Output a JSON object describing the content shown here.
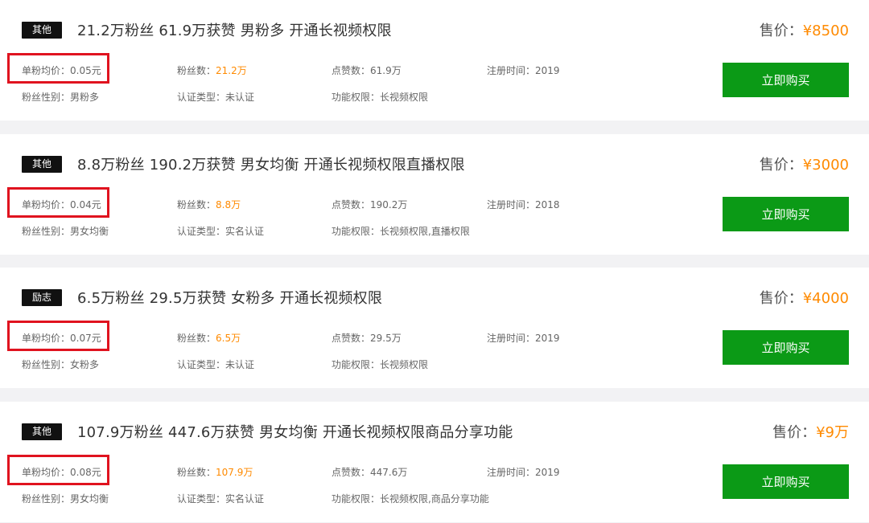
{
  "listings": [
    {
      "category": "其他",
      "title": "21.2万粉丝  61.9万获赞  男粉多  开通长视频权限",
      "price_label": "售价：",
      "price": "¥8500",
      "unit_price_label": "单粉均价：",
      "unit_price": "0.05元",
      "fans_label": "粉丝数：",
      "fans": "21.2万",
      "likes_label": "点赞数：",
      "likes": "61.9万",
      "reg_label": "注册时间：",
      "reg": "2019",
      "gender_label": "粉丝性别：",
      "gender": "男粉多",
      "cert_label": "认证类型：",
      "cert": "未认证",
      "perm_label": "功能权限：",
      "perm": "长视频权限",
      "buy_label": "立即购买"
    },
    {
      "category": "其他",
      "title": "8.8万粉丝  190.2万获赞  男女均衡  开通长视频权限直播权限",
      "price_label": "售价：",
      "price": "¥3000",
      "unit_price_label": "单粉均价：",
      "unit_price": "0.04元",
      "fans_label": "粉丝数：",
      "fans": "8.8万",
      "likes_label": "点赞数：",
      "likes": "190.2万",
      "reg_label": "注册时间：",
      "reg": "2018",
      "gender_label": "粉丝性别：",
      "gender": "男女均衡",
      "cert_label": "认证类型：",
      "cert": "实名认证",
      "perm_label": "功能权限：",
      "perm": "长视频权限,直播权限",
      "buy_label": "立即购买"
    },
    {
      "category": "励志",
      "title": "6.5万粉丝  29.5万获赞  女粉多  开通长视频权限",
      "price_label": "售价：",
      "price": "¥4000",
      "unit_price_label": "单粉均价：",
      "unit_price": "0.07元",
      "fans_label": "粉丝数：",
      "fans": "6.5万",
      "likes_label": "点赞数：",
      "likes": "29.5万",
      "reg_label": "注册时间：",
      "reg": "2019",
      "gender_label": "粉丝性别：",
      "gender": "女粉多",
      "cert_label": "认证类型：",
      "cert": "未认证",
      "perm_label": "功能权限：",
      "perm": "长视频权限",
      "buy_label": "立即购买"
    },
    {
      "category": "其他",
      "title": "107.9万粉丝  447.6万获赞  男女均衡  开通长视频权限商品分享功能",
      "price_label": "售价：",
      "price": "¥9万",
      "unit_price_label": "单粉均价：",
      "unit_price": "0.08元",
      "fans_label": "粉丝数：",
      "fans": "107.9万",
      "likes_label": "点赞数：",
      "likes": "447.6万",
      "reg_label": "注册时间：",
      "reg": "2019",
      "gender_label": "粉丝性别：",
      "gender": "男女均衡",
      "cert_label": "认证类型：",
      "cert": "实名认证",
      "perm_label": "功能权限：",
      "perm": "长视频权限,商品分享功能",
      "buy_label": "立即购买"
    }
  ],
  "colors": {
    "accent_orange": "#ff8a00",
    "buy_green": "#0b9a16",
    "highlight_red": "#e0131f",
    "tag_black": "#111111"
  }
}
